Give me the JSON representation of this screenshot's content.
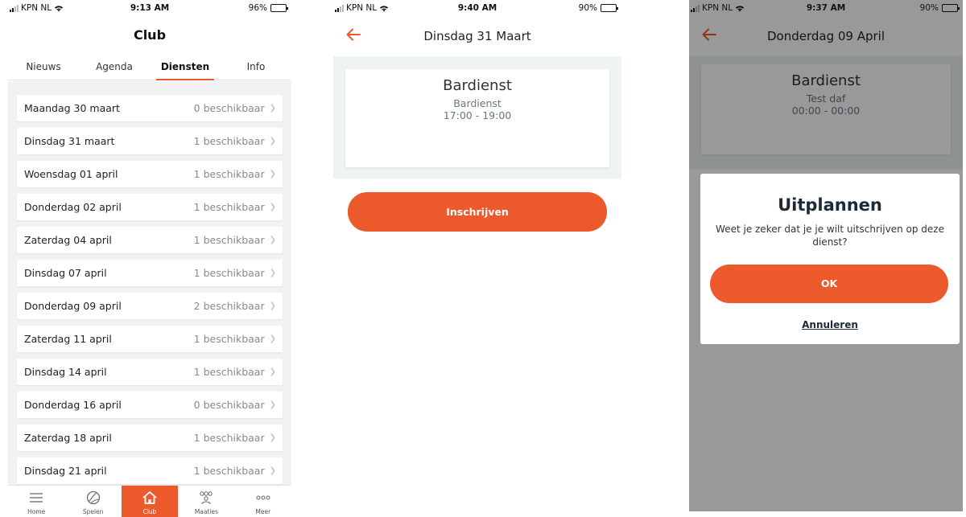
{
  "screen1": {
    "status": {
      "carrier": "KPN NL",
      "time": "9:13 AM",
      "battery": "96%",
      "battery_level": 0.96
    },
    "title": "Club",
    "tabs": [
      {
        "label": "Nieuws",
        "active": false
      },
      {
        "label": "Agenda",
        "active": false
      },
      {
        "label": "Diensten",
        "active": true
      },
      {
        "label": "Info",
        "active": false
      }
    ],
    "rows": [
      {
        "day": "Maandag 30 maart",
        "available": "0 beschikbaar"
      },
      {
        "day": "Dinsdag 31 maart",
        "available": "1 beschikbaar"
      },
      {
        "day": "Woensdag 01 april",
        "available": "1 beschikbaar"
      },
      {
        "day": "Donderdag 02 april",
        "available": "1 beschikbaar"
      },
      {
        "day": "Zaterdag 04 april",
        "available": "1 beschikbaar"
      },
      {
        "day": "Dinsdag 07 april",
        "available": "1 beschikbaar"
      },
      {
        "day": "Donderdag 09 april",
        "available": "2 beschikbaar"
      },
      {
        "day": "Zaterdag 11 april",
        "available": "1 beschikbaar"
      },
      {
        "day": "Dinsdag 14 april",
        "available": "1 beschikbaar"
      },
      {
        "day": "Donderdag 16 april",
        "available": "0 beschikbaar"
      },
      {
        "day": "Zaterdag 18 april",
        "available": "1 beschikbaar"
      },
      {
        "day": "Dinsdag 21 april",
        "available": "1 beschikbaar"
      }
    ],
    "nav": [
      {
        "label": "Home",
        "icon": "menu-icon",
        "active": false
      },
      {
        "label": "Spelen",
        "icon": "ball-icon",
        "active": false
      },
      {
        "label": "Club",
        "icon": "house-icon",
        "active": true
      },
      {
        "label": "Maaties",
        "icon": "people-icon",
        "active": false
      },
      {
        "label": "Meer",
        "icon": "more-icon",
        "active": false
      }
    ]
  },
  "screen2": {
    "status": {
      "carrier": "KPN NL",
      "time": "9:40 AM",
      "battery": "90%",
      "battery_level": 0.9
    },
    "header_title": "Dinsdag 31 Maart",
    "card": {
      "title": "Bardienst",
      "subtitle": "Bardienst",
      "time": "17:00 - 19:00"
    },
    "button": "Inschrijven"
  },
  "screen3": {
    "status": {
      "carrier": "KPN NL",
      "time": "9:37 AM",
      "battery": "90%",
      "battery_level": 0.9
    },
    "header_title": "Donderdag 09 April",
    "card": {
      "title": "Bardienst",
      "subtitle": "Test daf",
      "time": "00:00 - 00:00"
    },
    "modal": {
      "title": "Uitplannen",
      "text": "Weet je zeker dat je je wilt uitschrijven op deze dienst?",
      "ok": "OK",
      "cancel": "Annuleren"
    }
  },
  "colors": {
    "accent": "#ec5a2c",
    "panel": "#eef3f3",
    "list_bg": "#f2f2f2"
  }
}
